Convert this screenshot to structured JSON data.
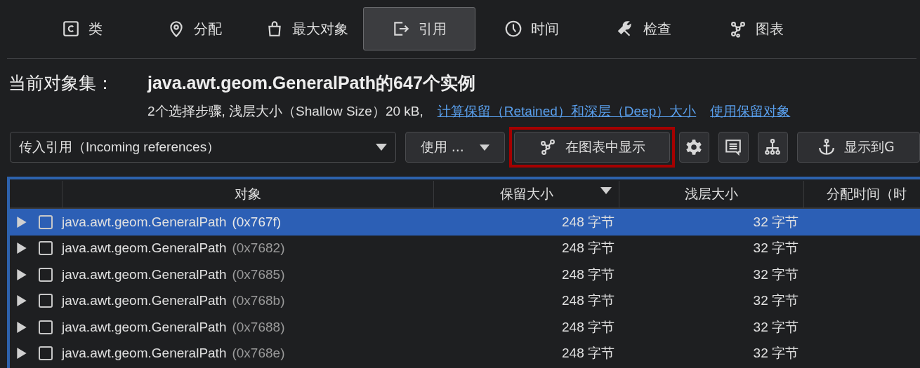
{
  "tabs": [
    {
      "label": "类",
      "selected": false
    },
    {
      "label": "分配",
      "selected": false
    },
    {
      "label": "最大对象",
      "selected": false
    },
    {
      "label": "引用",
      "selected": true
    },
    {
      "label": "时间",
      "selected": false
    },
    {
      "label": "检查",
      "selected": false
    },
    {
      "label": "图表",
      "selected": false
    }
  ],
  "header": {
    "label": "当前对象集：",
    "title": "java.awt.geom.GeneralPath的647个实例",
    "summary": "2个选择步骤, 浅层大小（Shallow Size）20 kB,",
    "links": [
      "计算保留（Retained）和深层（Deep）大小",
      "使用保留对象"
    ]
  },
  "toolbar": {
    "reference_dropdown": "传入引用（Incoming references）",
    "use_button": "使用 ...",
    "graph_button": {
      "label": "在图表中显示",
      "highlighted": true
    },
    "gc_button": "显示到G"
  },
  "table": {
    "columns": [
      {
        "label": "对象",
        "sorted": false
      },
      {
        "label": "保留大小",
        "sorted": true
      },
      {
        "label": "浅层大小",
        "sorted": false
      },
      {
        "label": "分配时间（时",
        "sorted": false
      }
    ],
    "rows": [
      {
        "name": "java.awt.geom.GeneralPath",
        "address": "(0x767f)",
        "retained": "248 字节",
        "shallow": "32 字节",
        "selected": true,
        "checked": false
      },
      {
        "name": "java.awt.geom.GeneralPath",
        "address": "(0x7682)",
        "retained": "248 字节",
        "shallow": "32 字节",
        "selected": false,
        "checked": false
      },
      {
        "name": "java.awt.geom.GeneralPath",
        "address": "(0x7685)",
        "retained": "248 字节",
        "shallow": "32 字节",
        "selected": false,
        "checked": false
      },
      {
        "name": "java.awt.geom.GeneralPath",
        "address": "(0x768b)",
        "retained": "248 字节",
        "shallow": "32 字节",
        "selected": false,
        "checked": false
      },
      {
        "name": "java.awt.geom.GeneralPath",
        "address": "(0x7688)",
        "retained": "248 字节",
        "shallow": "32 字节",
        "selected": false,
        "checked": false
      },
      {
        "name": "java.awt.geom.GeneralPath",
        "address": "(0x768e)",
        "retained": "248 字节",
        "shallow": "32 字节",
        "selected": false,
        "checked": false
      }
    ]
  }
}
